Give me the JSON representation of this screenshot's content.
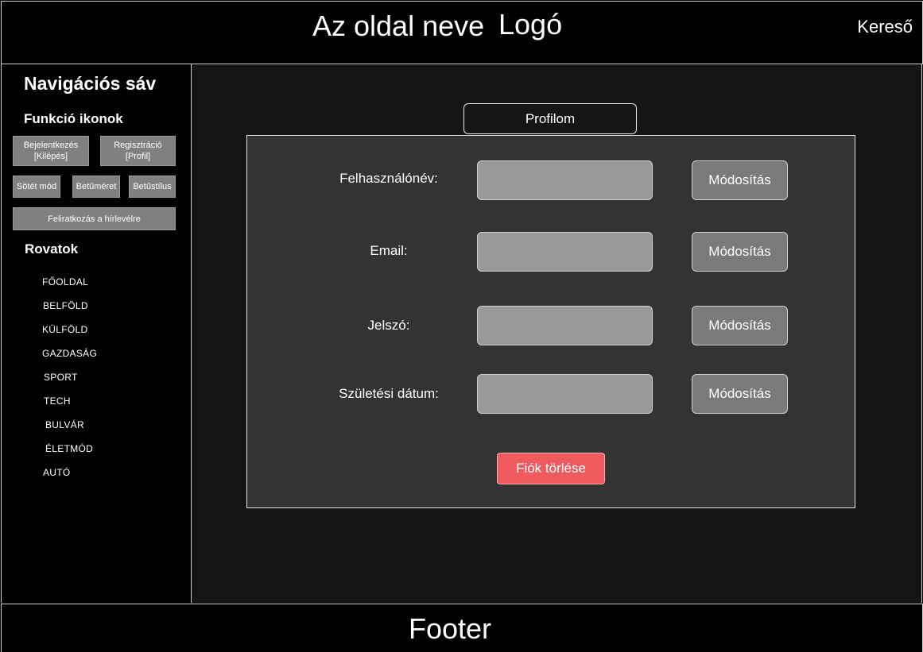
{
  "header": {
    "site_name": "Az oldal neve",
    "logo": "Logó",
    "search": "Kereső"
  },
  "sidebar": {
    "title": "Navigációs sáv",
    "functions_title": "Funkció ikonok",
    "buttons": {
      "login": "Bejelentkezés\n[Kilépés]",
      "register": "Regisztráció\n[Profil]",
      "dark_mode": "Sötét mód",
      "font_size": "Betűméret",
      "font_style": "Betűstílus",
      "newsletter": "Feliratkozás a hírlevélre"
    },
    "sections_title": "Rovatok",
    "sections": [
      "FŐOLDAL",
      "BELFÖLD",
      "KÜLFÖLD",
      "GAZDASÁG",
      "SPORT",
      "TECH",
      "BULVÁR",
      "ÉLETMÓD",
      "AUTÓ"
    ]
  },
  "main": {
    "profile_tab": "Profilom",
    "fields": [
      {
        "label": "Felhasználónév:",
        "value": "",
        "button": "Módosítás"
      },
      {
        "label": "Email:",
        "value": "",
        "button": "Módosítás"
      },
      {
        "label": "Jelszó:",
        "value": "",
        "button": "Módosítás"
      },
      {
        "label": "Születési dátum:",
        "value": "",
        "button": "Módosítás"
      }
    ],
    "delete_button": "Fiók törlése"
  },
  "footer": {
    "text": "Footer"
  },
  "colors": {
    "page_background": "#000000",
    "content_background": "#151515",
    "panel_background": "#333333",
    "input_background": "#999999",
    "button_background": "#7a7a7a",
    "sidebar_button_background": "#808080",
    "delete_button": "#ee5a5d",
    "text": "#ffffff"
  }
}
